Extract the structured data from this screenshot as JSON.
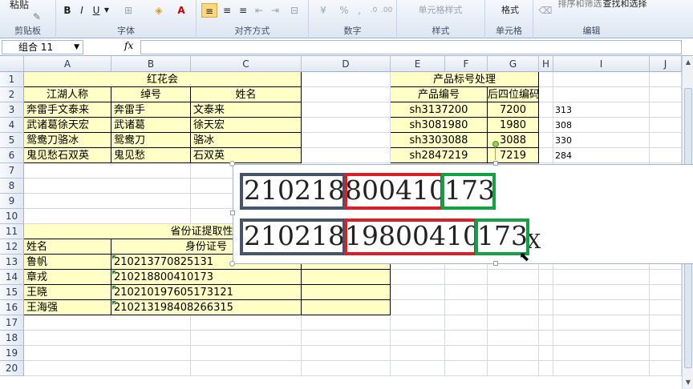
{
  "ribbon": {
    "clipboard": {
      "paste": "粘贴",
      "label": "剪贴板"
    },
    "font": {
      "bold": "B",
      "italic": "I",
      "underline": "U",
      "label": "字体"
    },
    "alignment": {
      "label": "对齐方式"
    },
    "number": {
      "percent": "%",
      "comma": ",",
      "label": "数字"
    },
    "styles": {
      "cell_styles": "单元格样式",
      "label": "样式"
    },
    "cells": {
      "format": "格式",
      "label": "单元格"
    },
    "editing": {
      "sort_filter": "排序和筛选",
      "find_select": "查找和选择",
      "label": "编辑"
    }
  },
  "formula_bar": {
    "name_box": "组合 11",
    "fx": "fx",
    "formula": ""
  },
  "columns": [
    "A",
    "B",
    "C",
    "D",
    "E",
    "F",
    "G",
    "H",
    "I",
    "J"
  ],
  "rows": [
    "1",
    "2",
    "3",
    "4",
    "5",
    "6",
    "7",
    "8",
    "9",
    "10",
    "11",
    "12",
    "13",
    "14",
    "15",
    "16",
    "17",
    "18",
    "19",
    "20"
  ],
  "table_hong": {
    "title": "红花会",
    "headers": [
      "江湖人称",
      "绰号",
      "姓名"
    ],
    "rows": [
      [
        "奔雷手文泰来",
        "奔雷手",
        "文泰来"
      ],
      [
        "武诸葛徐天宏",
        "武诸葛",
        "徐天宏"
      ],
      [
        "鸳鸯刀骆冰",
        "鸳鸯刀",
        "骆冰"
      ],
      [
        "鬼见愁石双英",
        "鬼见愁",
        "石双英"
      ]
    ]
  },
  "table_product": {
    "title": "产品标号处理",
    "headers": [
      "产品编号",
      "后四位编码"
    ],
    "rows": [
      [
        "sh3137200",
        "7200"
      ],
      [
        "sh3081980",
        "1980"
      ],
      [
        "sh3303088",
        "3088"
      ],
      [
        "sh2847219",
        "7219"
      ]
    ],
    "side_values": [
      "313",
      "308",
      "330",
      "284"
    ]
  },
  "table_id": {
    "title": "省份证提取性别",
    "header_name": "姓名",
    "header_id": "身份证号",
    "rows": [
      [
        "鲁帆",
        "210213770825131"
      ],
      [
        "章戎",
        "210218800410173"
      ],
      [
        "王晓",
        "210210197605173121"
      ],
      [
        "王海强",
        "210213198408266315"
      ]
    ]
  },
  "overlay": {
    "line1": {
      "prefix": "210218",
      "mid": "800410",
      "suffix": "173"
    },
    "line2": {
      "prefix": "210218",
      "mid": "19800410",
      "suffix": "173",
      "extra": "X"
    }
  },
  "colors": {
    "blue_box": "#44546a",
    "red_box": "#d91e25",
    "green_box": "#14a145",
    "cell_fill": "#ffffc6"
  }
}
